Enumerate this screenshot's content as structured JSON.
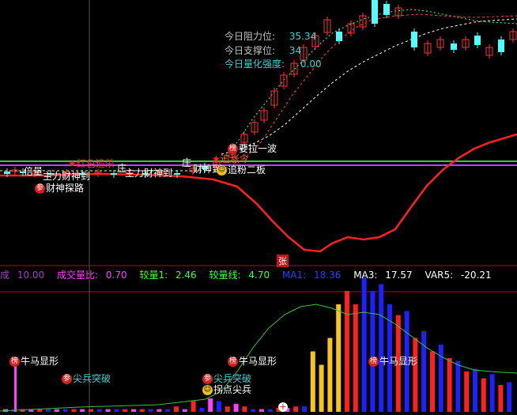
{
  "colors": {
    "background": "#000000",
    "candle_up": "#ff3232",
    "candle_down": "#54fcfc",
    "vol_red": "#ff2020",
    "vol_blue": "#2020ff",
    "vol_yellow": "#f5c518",
    "vol_magenta": "#ff40ff",
    "support_line": "#ff2020",
    "green_line": "#40c040",
    "magenta_line": "#c040ff",
    "white_dashed": "#ffffff",
    "stat_label": "#c0c0c0",
    "stat_value": "#40d0d0"
  },
  "stats": {
    "resistance_label": "今日阻力位:",
    "resistance_value": "35.34",
    "support_label": "今日支撑位:",
    "support_value": "34",
    "strength_label": "今日量化强度:",
    "strength_value": "0.00"
  },
  "price_annotations": [
    {
      "text": "红色追杀",
      "icon": "star-icon"
    },
    {
      "text": "倍量",
      "icon": ""
    },
    {
      "text": "主力财神到",
      "icon": ""
    },
    {
      "text": "庄",
      "icon": ""
    },
    {
      "text": "主力财神到",
      "icon": ""
    },
    {
      "text": "财神探路",
      "icon": "参"
    },
    {
      "text": "庄",
      "icon": ""
    },
    {
      "text": "财神到",
      "icon": ""
    },
    {
      "text": "要拉一波",
      "icon": "榜"
    },
    {
      "text": "追涨令",
      "icon": "star-icon"
    },
    {
      "text": "追粉二板",
      "icon": "smiley-icon"
    },
    {
      "text": "张",
      "icon": ""
    }
  ],
  "info_bar": {
    "item0_label": "成",
    "item0_value": "10.00",
    "item1_label": "成交量比:",
    "item1_value": "0.70",
    "item2_label": "较量1:",
    "item2_value": "2.46",
    "item3_label": "较量线:",
    "item3_value": "4.70",
    "item4_label": "MA1:",
    "item4_value": "18.36",
    "item5_label": "MA3:",
    "item5_value": "17.57",
    "item6_label": "VAR5:",
    "item6_value": "-20.21"
  },
  "volume_annotations": [
    {
      "text": "牛马显形",
      "icon": "榜"
    },
    {
      "text": "尖兵突破",
      "icon": "参"
    },
    {
      "text": "尖兵突破",
      "icon": "参"
    },
    {
      "text": "拐点尖兵",
      "icon": "smiley-icon"
    },
    {
      "text": "牛马显形",
      "icon": "榜"
    },
    {
      "text": "牛马显形",
      "icon": "榜"
    }
  ],
  "chart_data": {
    "type": "candlestick-volume",
    "candles": [
      {
        "o": 0,
        "c": 0
      },
      {
        "o": 0,
        "c": 0
      }
    ],
    "volume_relative": [
      0.02,
      0.02,
      0.02,
      0.02,
      0.02,
      0.02,
      0.02,
      0.02,
      0.02,
      0.02,
      0.02,
      0.02,
      0.02,
      0.02,
      0.02,
      0.02,
      0.02,
      0.02,
      0.02,
      0.02,
      0.04,
      0.02,
      0.08,
      0.03,
      0.1,
      0.08,
      0.04,
      0.06,
      0.04,
      0.02,
      0.02,
      0.02,
      0.03,
      0.03,
      0.04,
      0.04,
      0.45,
      0.35,
      0.55,
      0.8,
      0.9,
      0.8,
      1.0,
      0.9,
      0.95,
      0.8,
      0.72,
      0.75,
      0.55,
      0.6,
      0.45,
      0.5,
      0.4,
      0.38,
      0.3,
      0.32,
      0.25,
      0.28,
      0.2,
      0.22
    ]
  }
}
